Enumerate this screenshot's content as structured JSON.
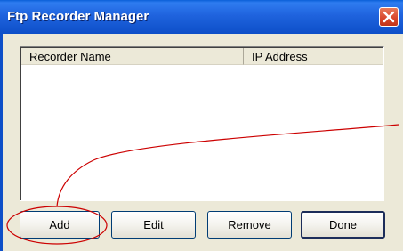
{
  "window": {
    "title": "Ftp Recorder Manager",
    "close_icon": "close-icon"
  },
  "listview": {
    "columns": [
      "Recorder Name",
      "IP Address"
    ],
    "rows": []
  },
  "buttons": {
    "add": "Add",
    "edit": "Edit",
    "remove": "Remove",
    "done": "Done"
  },
  "colors": {
    "titlebar": "#0d4fc8",
    "window_bg": "#ece9d8",
    "annotation": "#cc0000"
  }
}
